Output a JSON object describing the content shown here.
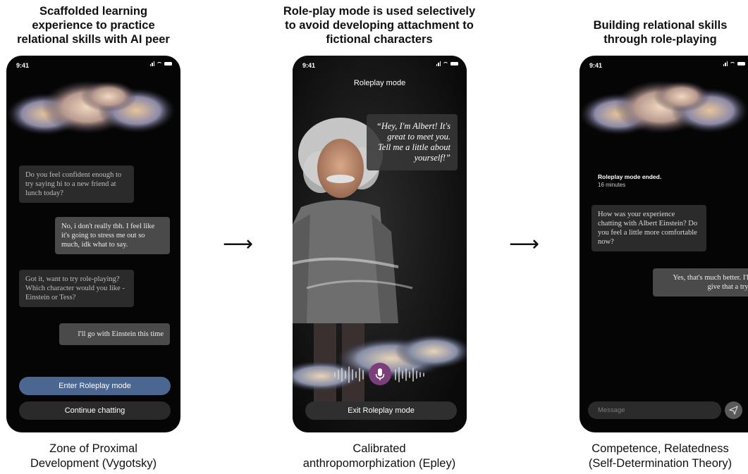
{
  "panels": [
    {
      "title_lines": [
        "Scaffolded learning",
        "experience to practice",
        "relational skills with AI peer"
      ],
      "caption_lines": [
        "Zone of Proximal",
        "Development (Vygotsky)"
      ],
      "status_time": "9:41",
      "messages": [
        {
          "role": "ai",
          "text": "Do you feel confident enough to try saying hi to a new friend at lunch today?"
        },
        {
          "role": "user",
          "text": "No, i don't really tbh. I feel like it's going to stress me out so much, idk what to say."
        },
        {
          "role": "ai",
          "text": "Got it, want to try role-playing? Which character would you like - Einstein or Tess?"
        },
        {
          "role": "user",
          "text": "I'll go with Einstein this time"
        }
      ],
      "primary_button": "Enter Roleplay mode",
      "secondary_button": "Continue chatting"
    },
    {
      "title_lines": [
        "Role-play mode is used selectively",
        "to avoid developing attachment to",
        "fictional characters"
      ],
      "caption_lines": [
        "Calibrated",
        "anthropomorphization (Epley)"
      ],
      "status_time": "9:41",
      "header": "Roleplay mode",
      "speech": "“Hey, I'm Albert! It's great to meet you. Tell me a little about yourself!”",
      "exit_button": "Exit Roleplay mode"
    },
    {
      "title_lines": [
        "Building relational skills",
        "through role-playing"
      ],
      "caption_lines": [
        "Competence, Relatedness",
        "(Self-Determination Theory)"
      ],
      "status_time": "9:41",
      "ended_title": "Roleplay mode ended.",
      "ended_duration": "16 minutes",
      "messages": [
        {
          "role": "ai",
          "text": "How was your experience chatting with Albert Einstein? Do you feel a little more comfortable now?"
        },
        {
          "role": "user",
          "text": "Yes, that's much better. I'll give that a try!"
        }
      ],
      "input_placeholder": "Message"
    }
  ],
  "arrows": [
    "⟶",
    "⟶"
  ],
  "icons": {
    "status": [
      "signal-icon",
      "wifi-icon",
      "battery-icon"
    ],
    "mic": "microphone-icon",
    "send": "send-icon"
  },
  "colors": {
    "phone_bg": "#050505",
    "ai_bubble": "#2b2b2b",
    "user_bubble": "#4a4a4a",
    "primary_button": "#4a6691",
    "mic_button": "#7a3f7a"
  }
}
